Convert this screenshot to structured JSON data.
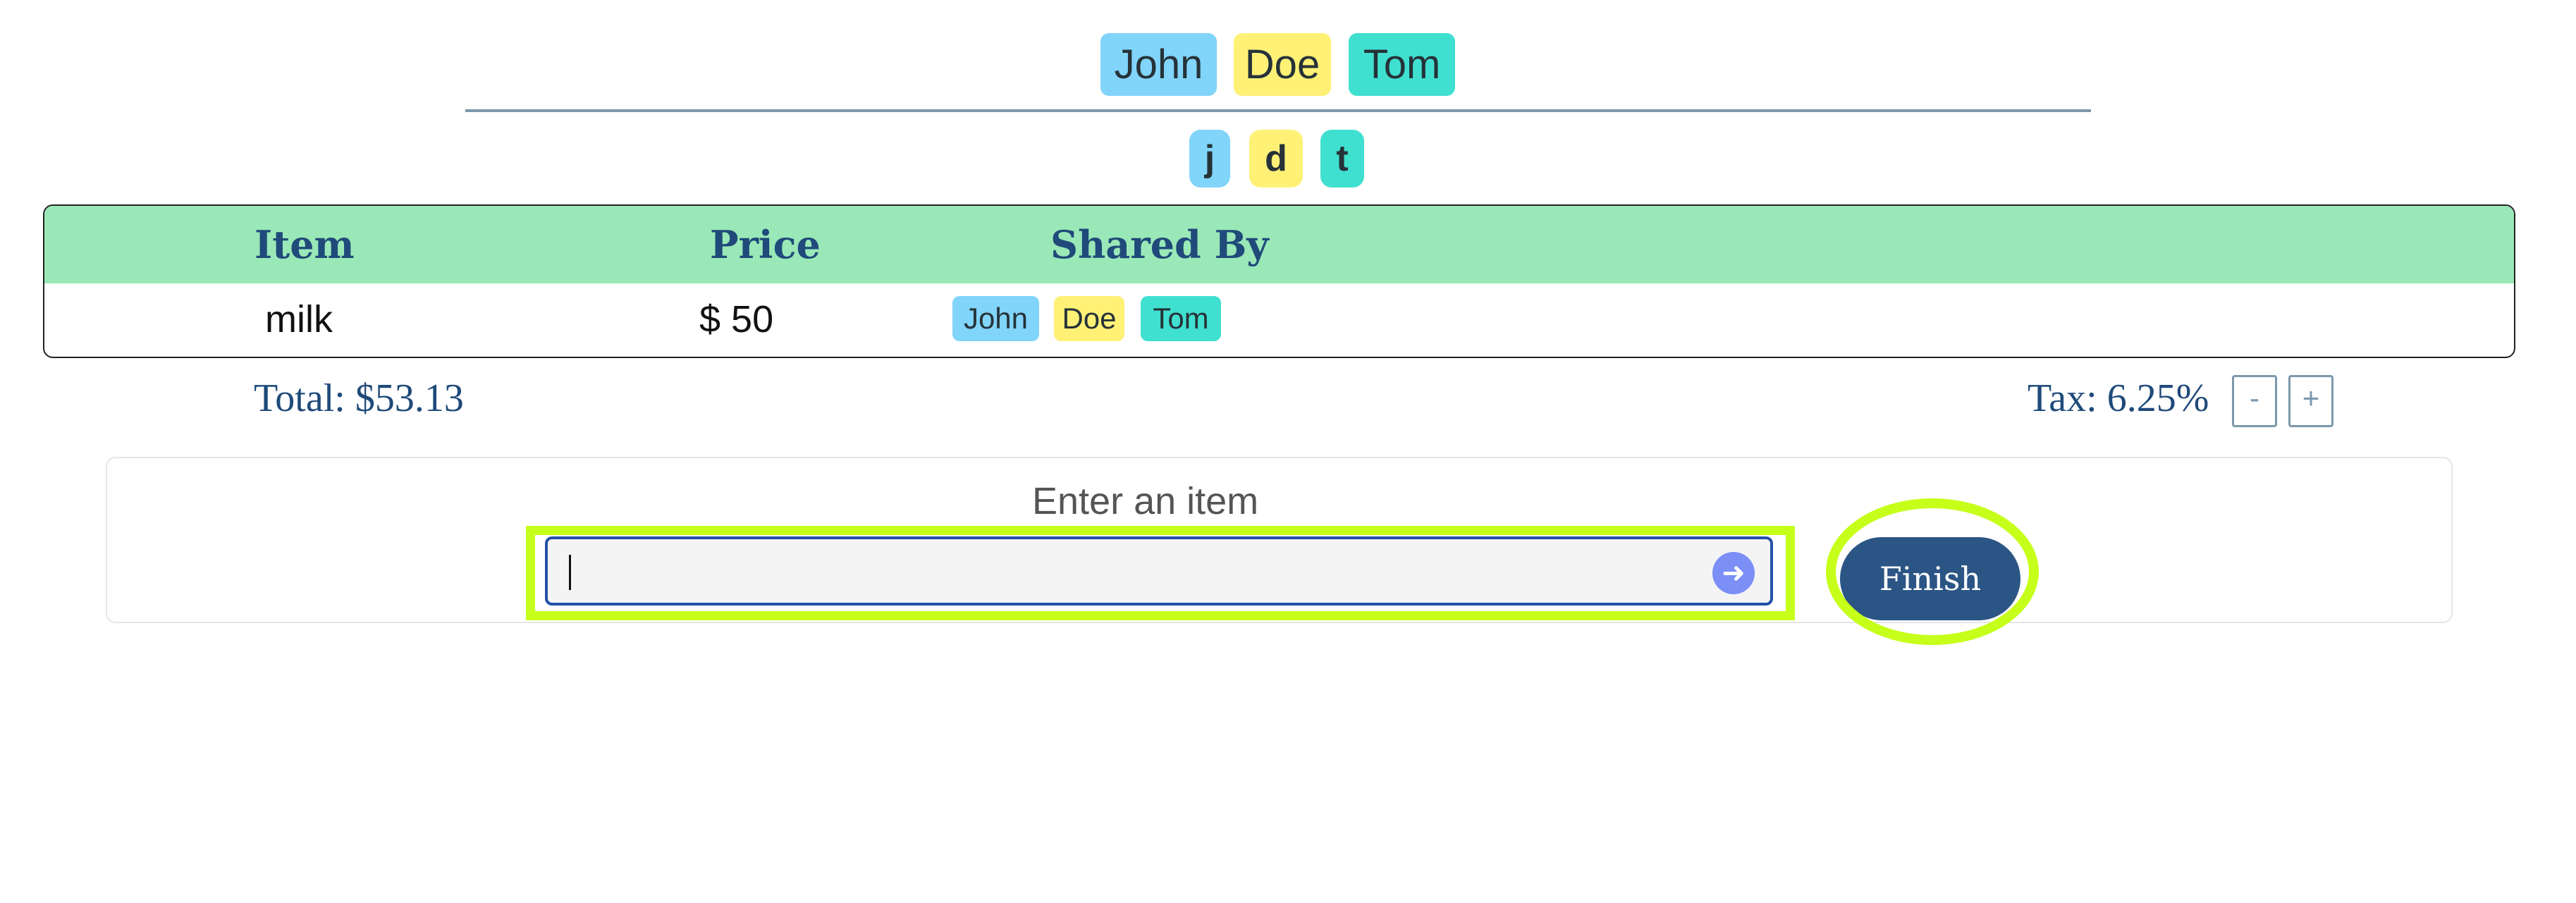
{
  "names": {
    "full": [
      "John",
      "Doe",
      "Tom"
    ],
    "initials": [
      "j",
      "d",
      "t"
    ]
  },
  "table": {
    "headers": [
      "Item",
      "Price",
      "Shared By"
    ],
    "rows": [
      {
        "item": "milk",
        "price": "$ 50",
        "shared_by": [
          "John",
          "Doe",
          "Tom"
        ]
      }
    ]
  },
  "summary": {
    "total": "Total: $53.13",
    "tax": "Tax: 6.25%",
    "decrease_label": "-",
    "increase_label": "+"
  },
  "entry": {
    "prompt": "Enter an item",
    "value": "",
    "submit_icon": "arrow-right-icon",
    "finish_label": "Finish"
  },
  "colors": {
    "chip_blue": "#81d4fa",
    "chip_yellow": "#fff176",
    "chip_teal": "#40e0d0",
    "header_green": "#9ae8b7",
    "primary": "#2b5584",
    "highlight": "#c6ff1a"
  }
}
